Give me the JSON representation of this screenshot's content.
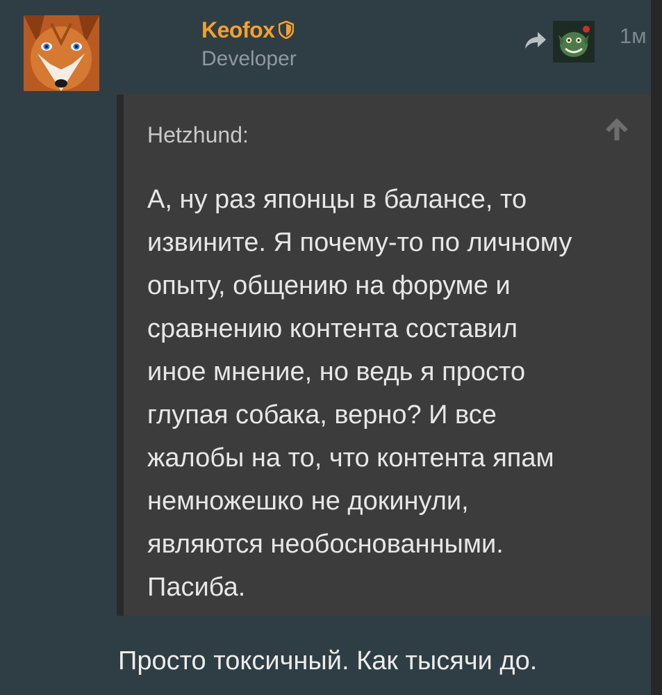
{
  "post": {
    "author": {
      "username": "Keofox",
      "title": "Developer",
      "avatar_icon": "fox-avatar",
      "badge_icon": "moderator-shield-icon",
      "username_color": "#f5a030"
    },
    "reply_to": {
      "icon": "reply-arrow-icon",
      "avatar_icon": "goblin-avatar"
    },
    "date": "1м",
    "quote": {
      "author": "Hetzhund:",
      "text": "А, ну раз японцы в балансе, то\nизвините. Я почему-то по личному\nопыту, общению на форуме и\nсравнению контента составил\nиное мнение, но ведь я просто\nглупая собака, верно? И все\nжалобы на то, что контента япам\nнемножешко не докинули,\nявляются необоснованными.\nПасиба.",
      "expand_icon": "arrow-up-icon"
    },
    "body": "Просто токсичный. Как тысячи до."
  },
  "colors": {
    "background": "#2f3e44",
    "quote_background": "#3c3c3c",
    "accent": "#f5a030"
  }
}
